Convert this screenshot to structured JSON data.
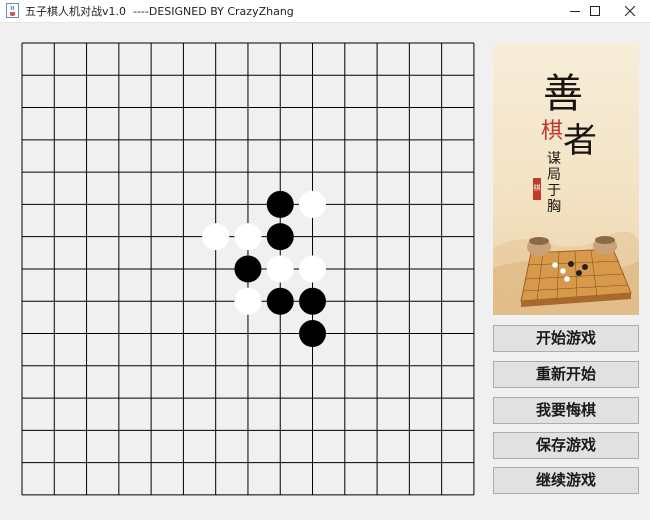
{
  "window": {
    "title": "五子棋人机对战v1.0  ----DESIGNED BY CrazyZhang",
    "icon": "java-cup-icon",
    "controls": [
      "minimize-icon",
      "maximize-icon",
      "close-icon"
    ]
  },
  "board": {
    "size": 15,
    "line_color": "#000000",
    "background": "#f0f0f0",
    "stones": [
      {
        "color": "black",
        "col": 8,
        "row": 5
      },
      {
        "color": "white",
        "col": 9,
        "row": 5
      },
      {
        "color": "white",
        "col": 6,
        "row": 6
      },
      {
        "color": "white",
        "col": 7,
        "row": 6
      },
      {
        "color": "black",
        "col": 8,
        "row": 6
      },
      {
        "color": "black",
        "col": 7,
        "row": 7
      },
      {
        "color": "white",
        "col": 8,
        "row": 7
      },
      {
        "color": "white",
        "col": 9,
        "row": 7
      },
      {
        "color": "white",
        "col": 7,
        "row": 8
      },
      {
        "color": "black",
        "col": 8,
        "row": 8
      },
      {
        "color": "black",
        "col": 9,
        "row": 8
      },
      {
        "color": "black",
        "col": 9,
        "row": 9
      }
    ]
  },
  "side_image": {
    "char_shan": "善",
    "char_qi": "棋",
    "char_zhe": "者",
    "tagline": [
      "谋",
      "局",
      "于",
      "胸"
    ],
    "seal": "棋",
    "colors": {
      "ink": "#1a1410",
      "red": "#c0392b"
    }
  },
  "buttons": [
    {
      "id": "start",
      "label": "开始游戏"
    },
    {
      "id": "restart",
      "label": "重新开始"
    },
    {
      "id": "undo",
      "label": "我要悔棋"
    },
    {
      "id": "save",
      "label": "保存游戏"
    },
    {
      "id": "continue",
      "label": "继续游戏"
    }
  ]
}
